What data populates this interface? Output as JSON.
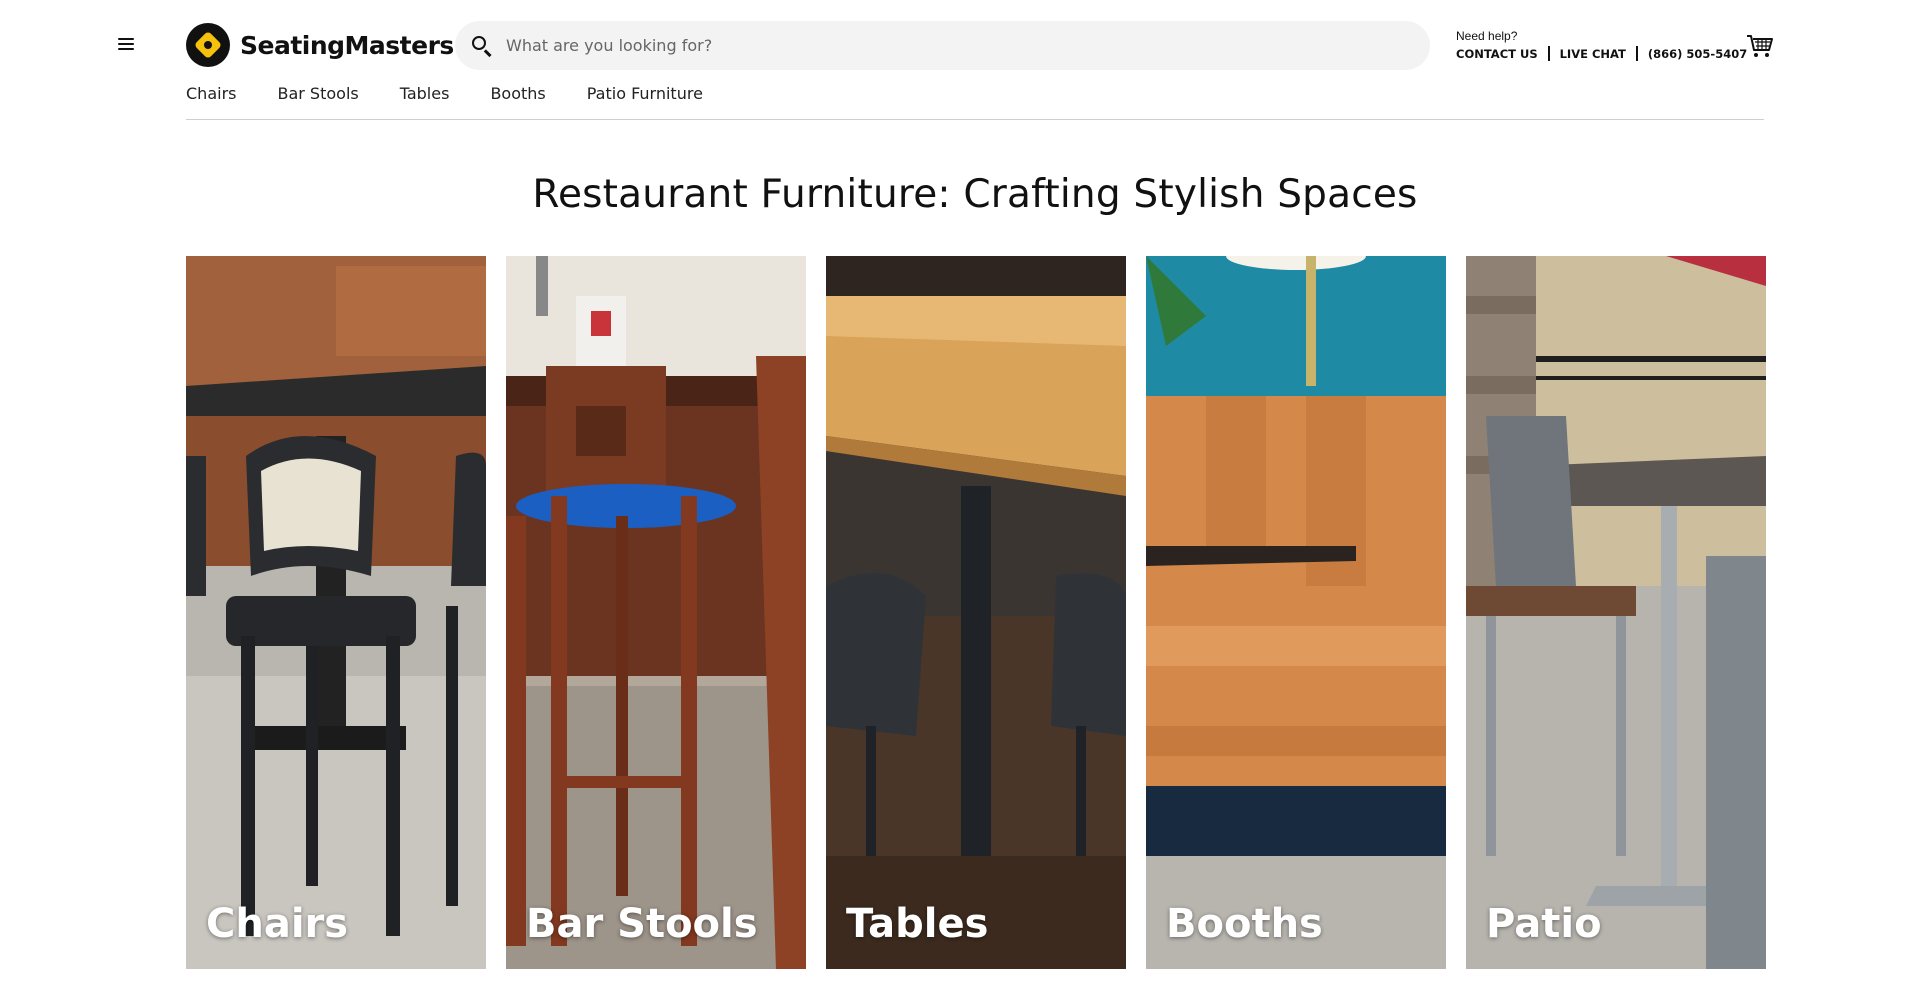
{
  "header": {
    "brand_name": "SeatingMasters",
    "search": {
      "placeholder": "What are you looking for?"
    },
    "help": {
      "label": "Need help?",
      "contact_us": "CONTACT US",
      "live_chat": "LIVE CHAT",
      "phone": "(866) 505-5407"
    },
    "icons": [
      "hamburger-menu-icon",
      "brand-logo-icon",
      "search-icon",
      "shopping-cart-icon"
    ]
  },
  "nav": {
    "items": [
      {
        "label": "Chairs"
      },
      {
        "label": "Bar Stools"
      },
      {
        "label": "Tables"
      },
      {
        "label": "Booths"
      },
      {
        "label": "Patio Furniture"
      }
    ]
  },
  "main": {
    "title": "Restaurant Furniture: Crafting Stylish Spaces",
    "categories": [
      {
        "label": "Chairs"
      },
      {
        "label": "Bar Stools"
      },
      {
        "label": "Tables"
      },
      {
        "label": "Booths"
      },
      {
        "label": "Patio"
      }
    ]
  },
  "colors": {
    "brand_yellow": "#f4c20d",
    "search_bg": "#f3f3f3",
    "text": "#111111"
  }
}
